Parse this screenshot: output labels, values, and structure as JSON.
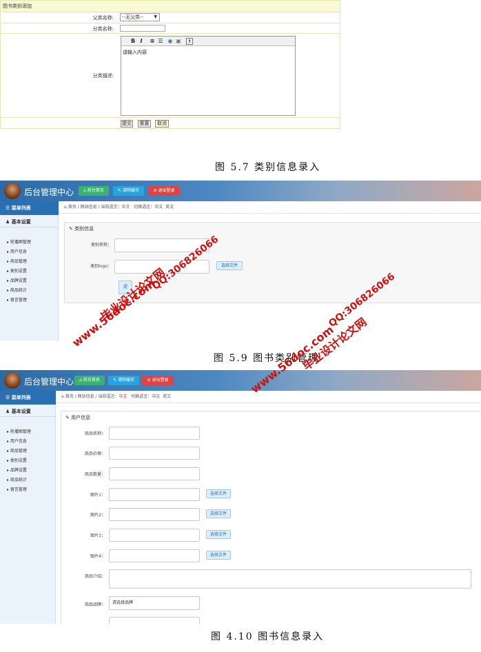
{
  "form1": {
    "title": "图书类别添加",
    "parent_label": "父类名称:",
    "parent_value": "--无父类--",
    "name_label": "分类名称:",
    "desc_label": "分类描述:",
    "editor_text": "请输入内容",
    "buttons": [
      "提交",
      "重置",
      "取消"
    ]
  },
  "caption1": "图 5.7 类别信息录入",
  "panel": {
    "title": "后台管理中心",
    "header_buttons": [
      "前台首页",
      "清除缓存",
      "退出登录"
    ],
    "header_button_colors": [
      "#3bb273",
      "#29a3e0",
      "#e04343"
    ],
    "menu_title": "菜单列表",
    "section": "基本设置",
    "menu_items": [
      "轮播图管理",
      "用户信息",
      "商品管理",
      "类别设置",
      "品牌设置",
      "商品统计",
      "留言管理"
    ],
    "breadcrumb": {
      "home": "首页",
      "site": "网站信息",
      "lang_label": "当前语言：",
      "lang": "中文",
      "switch_label": "切换语言：",
      "zh": "中文",
      "en": "英文"
    }
  },
  "panel1": {
    "card_title": "类别信息",
    "fields": [
      "类别名称：",
      "类别logo："
    ],
    "file_button": "选择文件",
    "submit_label": "提"
  },
  "caption2": "图 5.9 图书类别管理",
  "panel2": {
    "card_title": "用户信息",
    "fields": [
      "商品名称：",
      "商品价格：",
      "商品数量：",
      "图片1：",
      "图片2：",
      "图片3：",
      "图片4：",
      "商品介绍：",
      "商品品牌："
    ],
    "file_button": "选择文件",
    "brand_placeholder": "请选择品牌"
  },
  "caption3": "图 4.10 图书信息录入",
  "watermarks": {
    "site": "www.56doc.com",
    "qq": "QQ:306826066",
    "name": "毕业设计论文网"
  }
}
